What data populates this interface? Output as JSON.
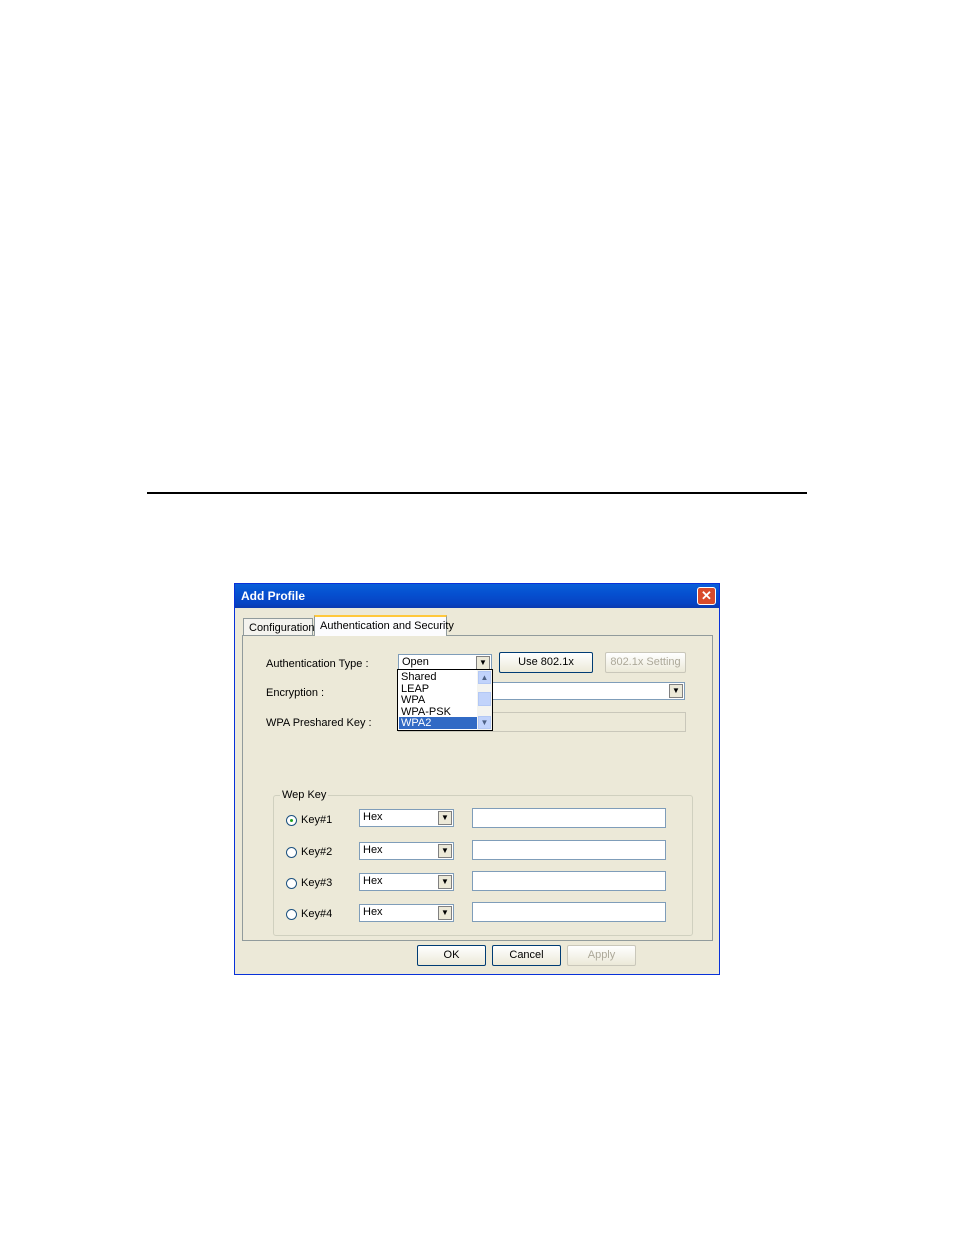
{
  "dialog": {
    "title": "Add Profile",
    "close_symbol": "✕",
    "tabs": [
      "Configuration",
      "Authentication and Security"
    ],
    "auth_type": {
      "label": "Authentication Type :",
      "value": "Open"
    },
    "use_8021x_label": "Use 802.1x",
    "setting_8021x_label": "802.1x Setting",
    "encryption": {
      "label": "Encryption :",
      "value": ""
    },
    "wpa_key": {
      "label": "WPA Preshared Key :",
      "value": ""
    },
    "auth_options": [
      "Shared",
      "LEAP",
      "WPA",
      "WPA-PSK",
      "WPA2"
    ],
    "auth_selected": "WPA2",
    "wep_key": {
      "legend": "Wep Key",
      "keys": [
        {
          "label": "Key#1",
          "format": "Hex",
          "value": "",
          "selected": true
        },
        {
          "label": "Key#2",
          "format": "Hex",
          "value": "",
          "selected": false
        },
        {
          "label": "Key#3",
          "format": "Hex",
          "value": "",
          "selected": false
        },
        {
          "label": "Key#4",
          "format": "Hex",
          "value": "",
          "selected": false
        }
      ]
    },
    "buttons": {
      "ok": "OK",
      "cancel": "Cancel",
      "apply": "Apply"
    },
    "icons": {
      "dropdown_arrow": "▼",
      "scroll_up": "▲",
      "scroll_down": "▼"
    }
  }
}
